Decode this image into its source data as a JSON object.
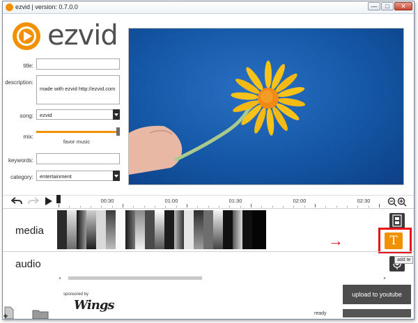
{
  "window": {
    "title": "ezvid | version: 0.7.0.0",
    "minimize_label": "—",
    "maximize_label": "□",
    "close_label": "✕"
  },
  "logo": {
    "text": "ezvid"
  },
  "form": {
    "title_label": "title:",
    "title_value": "",
    "description_label": "description:",
    "description_value": "made with ezvid http://ezvid.com",
    "song_label": "song:",
    "song_value": "ezvid",
    "mix_label": "mix:",
    "mix_caption": "favor music",
    "mix_level": 0.97,
    "keywords_label": "keywords:",
    "keywords_value": "",
    "category_label": "category:",
    "category_value": "entertainment"
  },
  "timeline": {
    "undo_icon": "undo-arrow-icon",
    "redo_icon": "redo-arrow-icon",
    "play_icon": "play-icon",
    "ticks": [
      "00:30",
      "01:00",
      "01:30",
      "02:00",
      "02:30"
    ],
    "zoom_out_icon": "zoom-out-icon",
    "zoom_in_icon": "zoom-in-icon"
  },
  "tracks": {
    "media_label": "media",
    "audio_label": "audio"
  },
  "side_tools": {
    "film_icon": "film-strip-icon",
    "text_button_glyph": "T",
    "text_icon": "add-text-icon",
    "microphone_icon": "microphone-icon",
    "tooltip": "add te",
    "annotation_arrow": "→"
  },
  "footer": {
    "sponsored_label": "sponsored by",
    "sponsor_logo_text": "Wings",
    "upload_label": "upload to youtube",
    "status_text": "ready",
    "add_icon": "add-file-icon",
    "folder_icon": "folder-icon"
  },
  "colors": {
    "accent": "#f29100",
    "annotation": "#e6121a",
    "dark_button": "#4d4d4d",
    "preview_sky": "#1457a6"
  }
}
